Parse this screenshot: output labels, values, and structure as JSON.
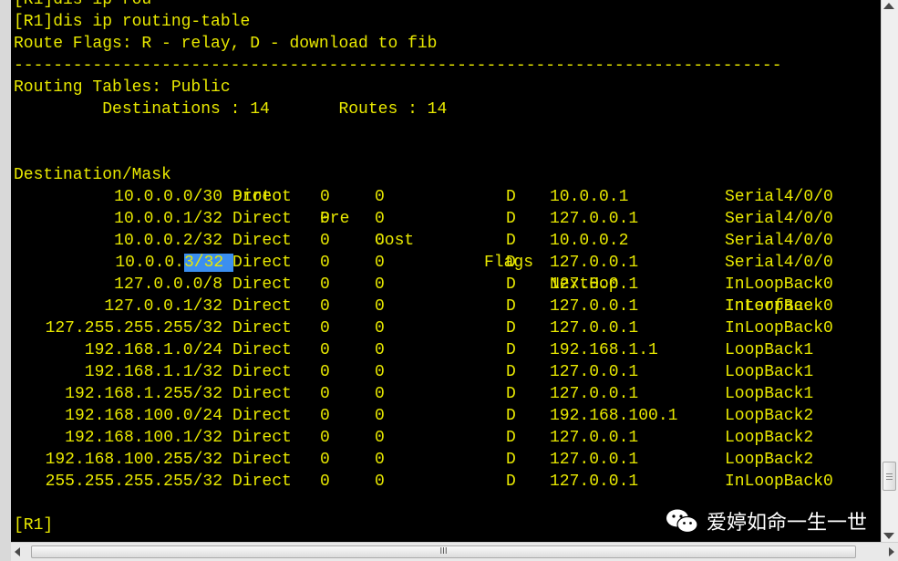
{
  "terminal": {
    "lines": [
      "[R1]dis ip rou",
      "[R1]dis ip routing-table",
      "Route Flags: R - relay, D - download to fib",
      "------------------------------------------------------------------------------",
      "Routing Tables: Public",
      "         Destinations : 14       Routes : 14",
      "",
      "",
      "",
      "",
      "",
      "",
      "",
      "",
      "",
      "",
      "",
      "",
      "",
      "",
      "",
      "",
      "",
      "[R1]"
    ],
    "headers": {
      "dest": "Destination/Mask",
      "proto": "Proto",
      "pre": "Pre",
      "cost": "Cost",
      "flags": "Flags",
      "nexthop": "NextHop",
      "iface": "Interface"
    },
    "rows": [
      {
        "dest": "10.0.0.0/30",
        "proto": "Direct",
        "pre": "0",
        "cost": "0",
        "flags": "D",
        "nexthop": "10.0.0.1",
        "iface": "Serial4/0/0"
      },
      {
        "dest": "10.0.0.1/32",
        "proto": "Direct",
        "pre": "0",
        "cost": "0",
        "flags": "D",
        "nexthop": "127.0.0.1",
        "iface": "Serial4/0/0"
      },
      {
        "dest": "10.0.0.2/32",
        "proto": "Direct",
        "pre": "0",
        "cost": "0",
        "flags": "D",
        "nexthop": "10.0.0.2",
        "iface": "Serial4/0/0"
      },
      {
        "dest_pre": "10.0.0.",
        "dest_sel": "3/32 ",
        "proto": "Direct",
        "pre": "0",
        "cost": "0",
        "flags": "D",
        "nexthop": "127.0.0.1",
        "iface": "Serial4/0/0"
      },
      {
        "dest": "127.0.0.0/8",
        "proto": "Direct",
        "pre": "0",
        "cost": "0",
        "flags": "D",
        "nexthop": "127.0.0.1",
        "iface": "InLoopBack0"
      },
      {
        "dest": "127.0.0.1/32",
        "proto": "Direct",
        "pre": "0",
        "cost": "0",
        "flags": "D",
        "nexthop": "127.0.0.1",
        "iface": "InLoopBack0"
      },
      {
        "dest": "127.255.255.255/32",
        "proto": "Direct",
        "pre": "0",
        "cost": "0",
        "flags": "D",
        "nexthop": "127.0.0.1",
        "iface": "InLoopBack0"
      },
      {
        "dest": "192.168.1.0/24",
        "proto": "Direct",
        "pre": "0",
        "cost": "0",
        "flags": "D",
        "nexthop": "192.168.1.1",
        "iface": "LoopBack1"
      },
      {
        "dest": "192.168.1.1/32",
        "proto": "Direct",
        "pre": "0",
        "cost": "0",
        "flags": "D",
        "nexthop": "127.0.0.1",
        "iface": "LoopBack1"
      },
      {
        "dest": "192.168.1.255/32",
        "proto": "Direct",
        "pre": "0",
        "cost": "0",
        "flags": "D",
        "nexthop": "127.0.0.1",
        "iface": "LoopBack1"
      },
      {
        "dest": "192.168.100.0/24",
        "proto": "Direct",
        "pre": "0",
        "cost": "0",
        "flags": "D",
        "nexthop": "192.168.100.1",
        "iface": "LoopBack2"
      },
      {
        "dest": "192.168.100.1/32",
        "proto": "Direct",
        "pre": "0",
        "cost": "0",
        "flags": "D",
        "nexthop": "127.0.0.1",
        "iface": "LoopBack2"
      },
      {
        "dest": "192.168.100.255/32",
        "proto": "Direct",
        "pre": "0",
        "cost": "0",
        "flags": "D",
        "nexthop": "127.0.0.1",
        "iface": "LoopBack2"
      },
      {
        "dest": "255.255.255.255/32",
        "proto": "Direct",
        "pre": "0",
        "cost": "0",
        "flags": "D",
        "nexthop": "127.0.0.1",
        "iface": "InLoopBack0"
      }
    ]
  },
  "scrollbar": {
    "h_thumb_grip": "III"
  },
  "watermark": {
    "text": "爱婷如命一生一世",
    "icon": "wechat-icon"
  },
  "colors": {
    "text": "#e8e800",
    "background": "#000000",
    "selection": "#3b8ff0"
  }
}
